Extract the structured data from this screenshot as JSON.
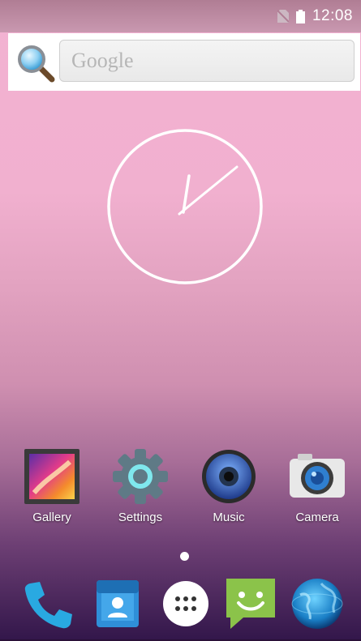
{
  "status_bar": {
    "time": "12:08",
    "icons": [
      "no-sim-icon",
      "battery-icon"
    ]
  },
  "search": {
    "placeholder": "Google",
    "icon": "search-icon"
  },
  "clock_widget": {
    "type": "analog-clock",
    "time": "12:08"
  },
  "apps": [
    {
      "label": "Gallery",
      "icon": "gallery-icon"
    },
    {
      "label": "Settings",
      "icon": "settings-icon"
    },
    {
      "label": "Music",
      "icon": "music-icon"
    },
    {
      "label": "Camera",
      "icon": "camera-icon"
    }
  ],
  "page_indicator": {
    "pages": 1,
    "current": 1
  },
  "dock": [
    {
      "name": "phone",
      "icon": "phone-icon"
    },
    {
      "name": "contacts",
      "icon": "contacts-icon"
    },
    {
      "name": "all-apps",
      "icon": "app-drawer-icon"
    },
    {
      "name": "messaging",
      "icon": "messaging-icon"
    },
    {
      "name": "browser",
      "icon": "globe-icon"
    }
  ],
  "colors": {
    "wallpaper_top": "#f3b2d2",
    "wallpaper_bottom": "#32164a",
    "accent_green": "#8bc34a",
    "phone_blue": "#29a9e1"
  }
}
